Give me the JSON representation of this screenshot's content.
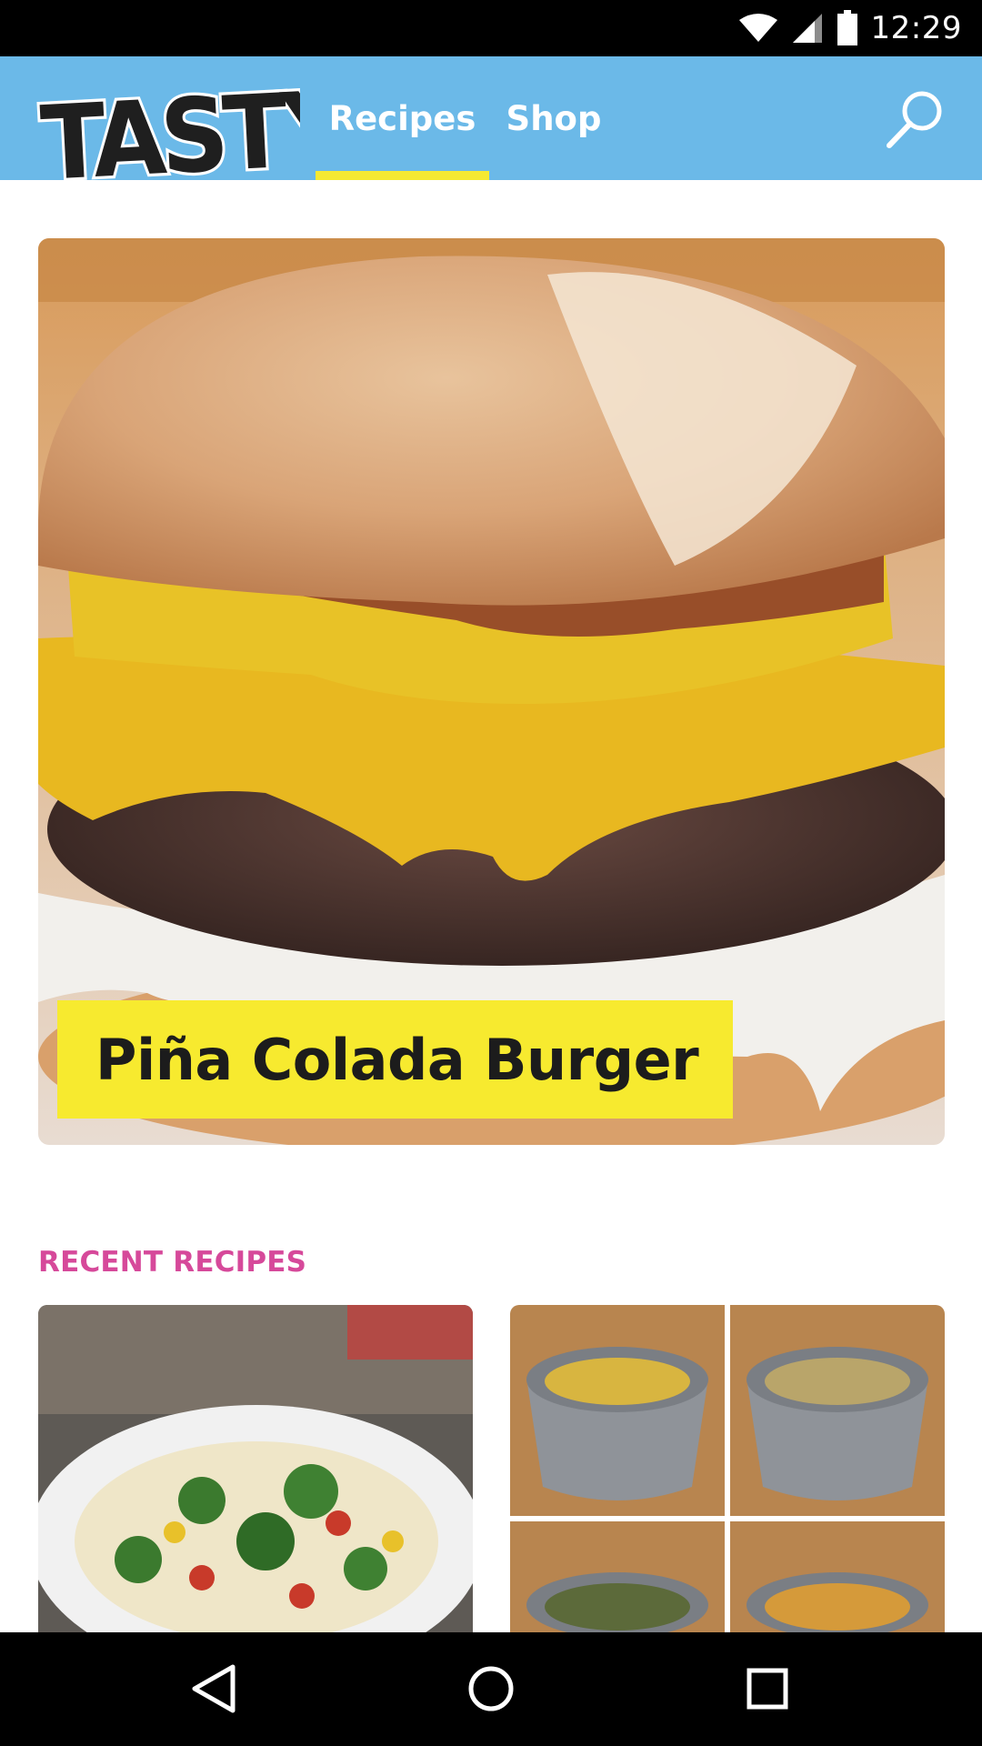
{
  "status_bar": {
    "time": "12:29",
    "icons": [
      "wifi-icon",
      "cellular-signal-icon",
      "battery-icon"
    ]
  },
  "app_bar": {
    "logo_text": "TASTY",
    "tabs": [
      {
        "label": "Recipes",
        "active": true
      },
      {
        "label": "Shop",
        "active": false
      }
    ],
    "search_icon": "search-icon",
    "colors": {
      "background": "#6bb9e8",
      "active_underline": "#f5e933"
    }
  },
  "hero": {
    "title": "Piña Colada Burger",
    "image": "pina-colada-burger-photo",
    "title_background": "#f7ea2f"
  },
  "recent": {
    "section_title": "RECENT RECIPES",
    "section_color": "#d6499a",
    "cards": [
      {
        "image": "pasta-salad-bowl-photo"
      },
      {
        "image": "four-bowls-grid-photo"
      }
    ]
  },
  "nav_bar": {
    "buttons": [
      "back-icon",
      "home-icon",
      "recents-icon"
    ]
  }
}
